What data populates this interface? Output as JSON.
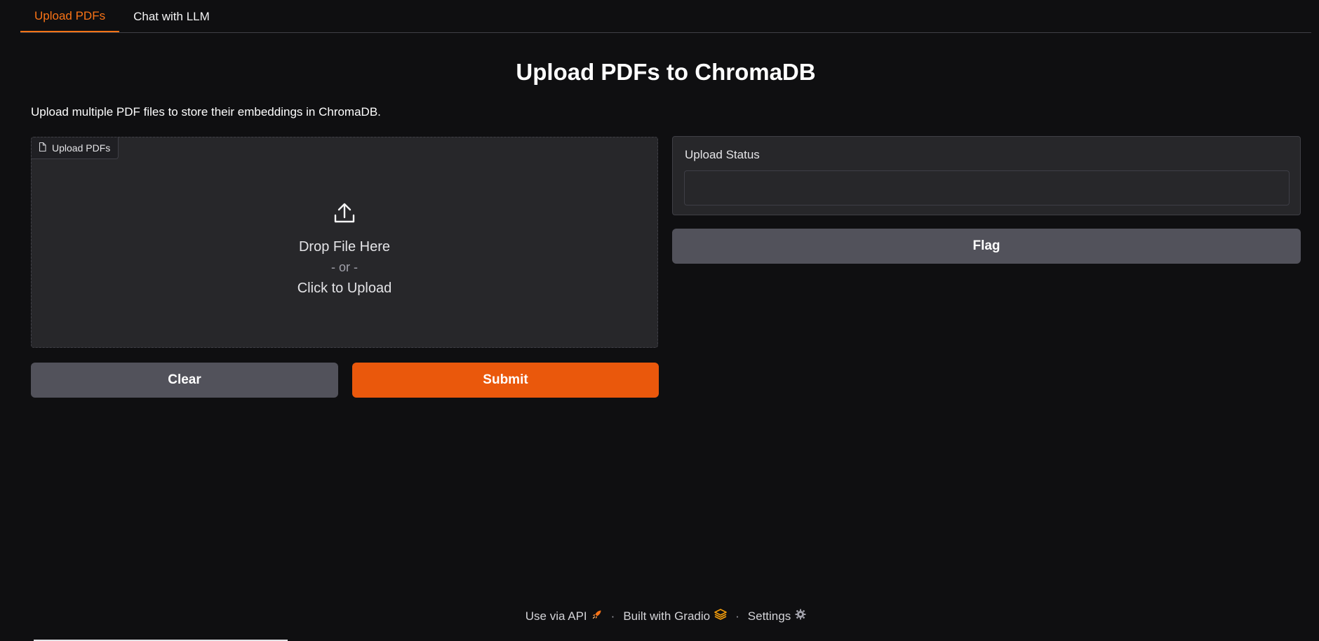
{
  "tabs": [
    {
      "label": "Upload PDFs",
      "active": true
    },
    {
      "label": "Chat with LLM",
      "active": false
    }
  ],
  "page_title": "Upload PDFs to ChromaDB",
  "description": "Upload multiple PDF files to store their embeddings in ChromaDB.",
  "upload": {
    "label": "Upload PDFs",
    "label_icon": "file-icon",
    "icon": "upload-icon",
    "drop_text": "Drop File Here",
    "or_text": "- or -",
    "click_text": "Click to Upload"
  },
  "buttons": {
    "clear": "Clear",
    "submit": "Submit",
    "flag": "Flag"
  },
  "status": {
    "label": "Upload Status",
    "value": ""
  },
  "footer": {
    "api": "Use via API",
    "api_icon": "rocket-icon",
    "built": "Built with Gradio",
    "built_icon": "gradio-logo-icon",
    "settings": "Settings",
    "settings_icon": "gear-icon",
    "separator": "·"
  },
  "colors": {
    "background": "#0f0f11",
    "accent": "#f97316",
    "submit": "#ea580c",
    "secondary_button": "#52525b",
    "panel": "#27272a"
  }
}
